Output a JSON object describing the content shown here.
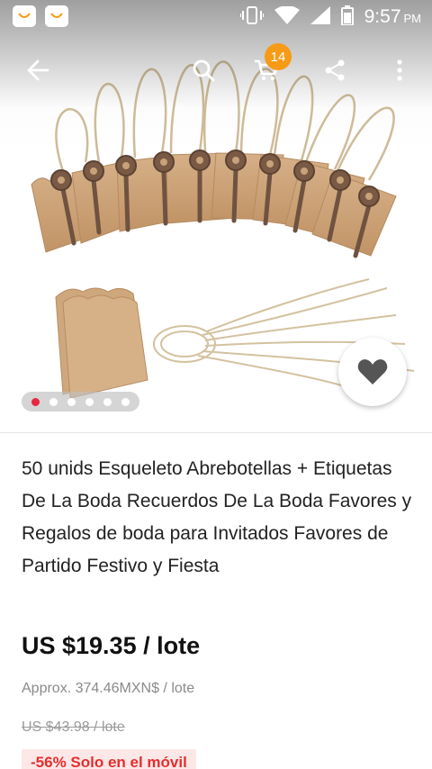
{
  "status_bar": {
    "time": "9:57",
    "ampm": "PM",
    "icons": [
      "app-icon",
      "app-icon",
      "vibrate-icon",
      "wifi-icon",
      "signal-icon",
      "battery-icon"
    ]
  },
  "toolbar": {
    "icons": [
      "back-arrow-icon",
      "search-icon",
      "cart-icon",
      "share-icon",
      "more-vert-icon"
    ],
    "cart_count": "14"
  },
  "gallery": {
    "image_count": 6,
    "active_index": 0
  },
  "product": {
    "title": "50 unids Esqueleto Abrebotellas + Etiquetas De La Boda Recuerdos De La Boda Favores y Regalos de boda para Invitados Favores de Partido Festivo y Fiesta",
    "price": "US $19.35 / lote",
    "approx_price": "Approx. 374.46MXN$ / lote",
    "original_price": "US $43.98 / lote",
    "promo": "-56% Solo en el móvil"
  },
  "colors": {
    "accent_red": "#e9283f",
    "badge_orange": "#f79a16",
    "kraft_tag": "#c99f70",
    "key_bronze": "#7a5a44"
  }
}
